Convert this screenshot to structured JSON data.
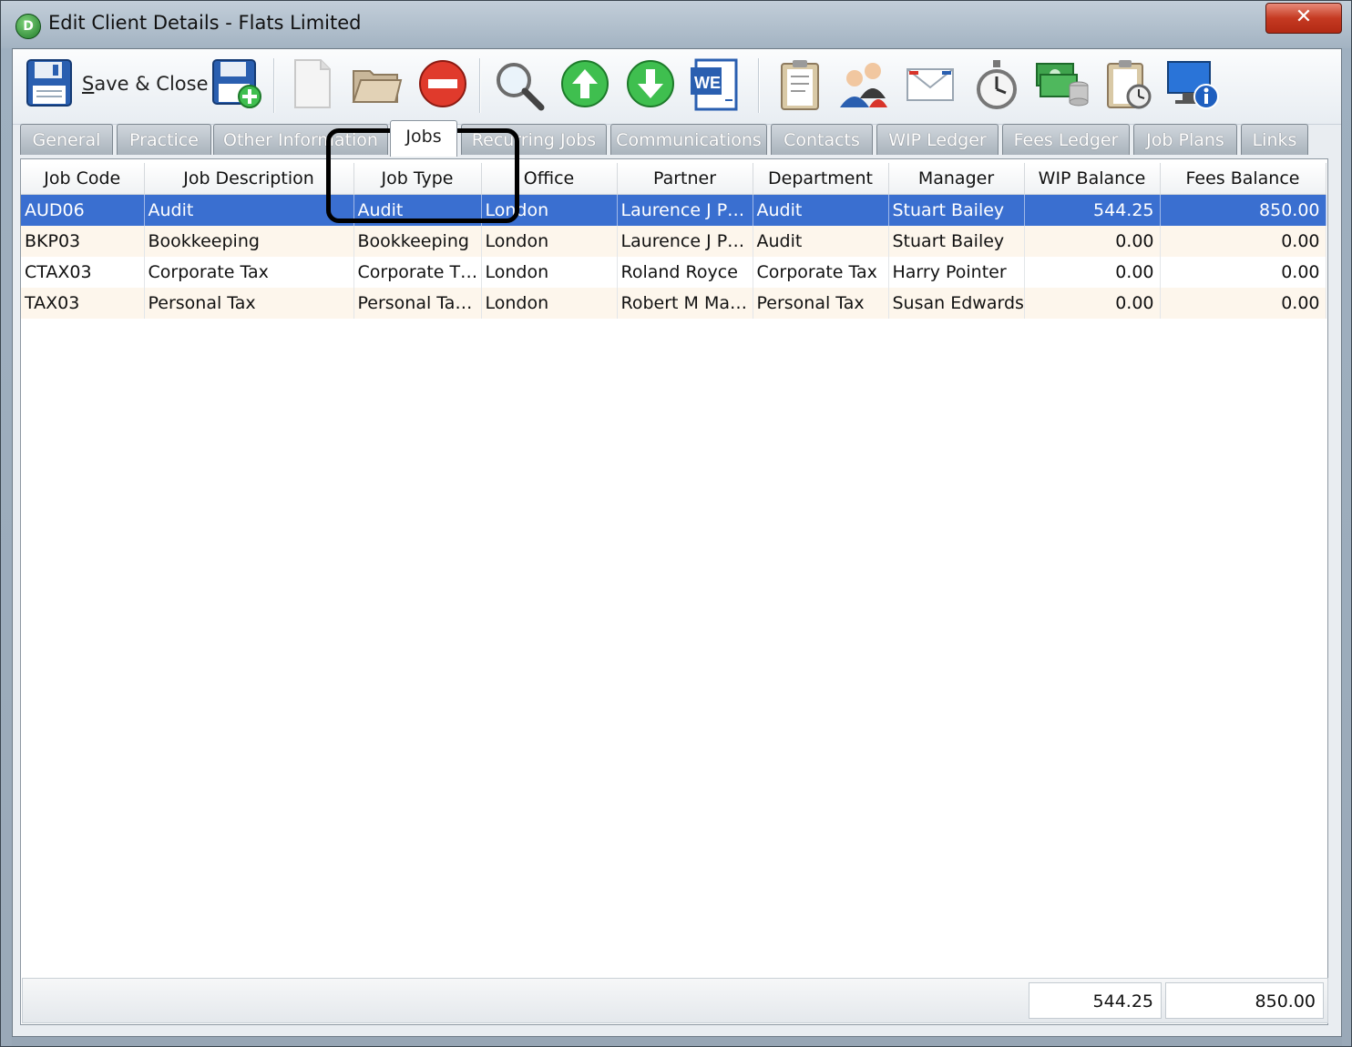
{
  "window": {
    "title": "Edit Client Details - Flats Limited",
    "app_icon_letter": "D",
    "close_glyph": "✕"
  },
  "toolbar": {
    "save_close_label_accel": "S",
    "save_close_label_rest": "ave & Close",
    "icons": [
      "save-icon",
      "save-new-icon",
      "new-document-icon",
      "open-folder-icon",
      "delete-icon",
      "search-icon",
      "move-up-icon",
      "move-down-icon",
      "word-icon",
      "clipboard-icon",
      "users-icon",
      "email-icon",
      "stopwatch-icon",
      "money-icon",
      "clipboard-clock-icon",
      "info-monitor-icon"
    ]
  },
  "tabs": [
    {
      "label": "General"
    },
    {
      "label": "Practice"
    },
    {
      "label": "Other Information"
    },
    {
      "label": "Jobs"
    },
    {
      "label": "Recurring Jobs"
    },
    {
      "label": "Communications"
    },
    {
      "label": "Contacts"
    },
    {
      "label": "WIP Ledger"
    },
    {
      "label": "Fees Ledger"
    },
    {
      "label": "Job Plans"
    },
    {
      "label": "Links"
    }
  ],
  "active_tab": "Jobs",
  "grid": {
    "columns": [
      "Job Code",
      "Job Description",
      "Job Type",
      "Office",
      "Partner",
      "Department",
      "Manager",
      "WIP Balance",
      "Fees Balance"
    ],
    "rows": [
      [
        "AUD06",
        "Audit",
        "Audit",
        "London",
        "Laurence J P…",
        "Audit",
        "Stuart Bailey",
        "544.25",
        "850.00"
      ],
      [
        "BKP03",
        "Bookkeeping",
        "Bookkeeping",
        "London",
        "Laurence J P…",
        "Audit",
        "Stuart Bailey",
        "0.00",
        "0.00"
      ],
      [
        "CTAX03",
        "Corporate Tax",
        "Corporate T…",
        "London",
        "Roland Royce",
        "Corporate Tax",
        "Harry Pointer",
        "0.00",
        "0.00"
      ],
      [
        "TAX03",
        "Personal Tax",
        "Personal Ta…",
        "London",
        "Robert M Ma…",
        "Personal Tax",
        "Susan Edwards",
        "0.00",
        "0.00"
      ]
    ],
    "selected_row": 0
  },
  "totals": {
    "wip_total": "544.25",
    "fees_total": "850.00"
  },
  "colors": {
    "selection": "#3a6fd0",
    "alt_row": "#fdf6ec",
    "close_button": "#c53a22"
  }
}
